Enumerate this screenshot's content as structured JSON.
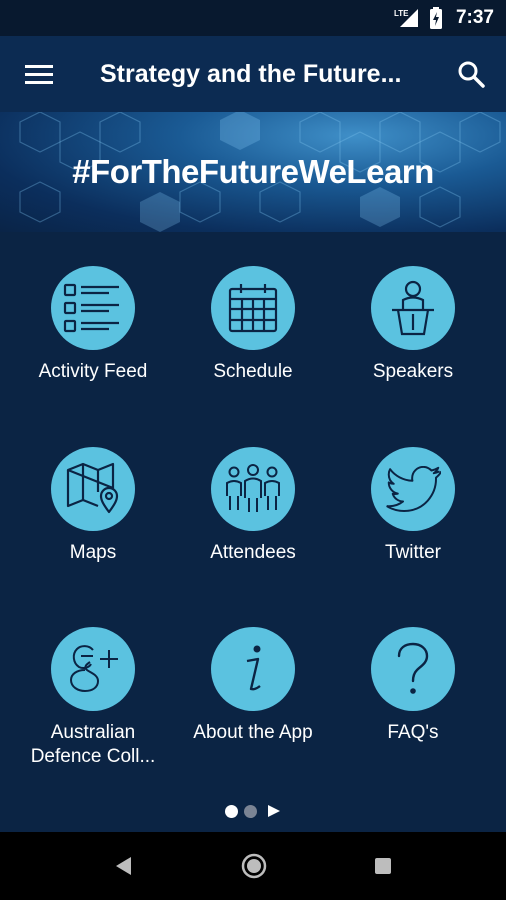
{
  "status_bar": {
    "network": "LTE",
    "time": "7:37"
  },
  "app_bar": {
    "title": "Strategy and the Future..."
  },
  "banner": {
    "hashtag": "#ForTheFutureWeLearn"
  },
  "tiles": [
    {
      "label": "Activity Feed",
      "icon": "activity-feed-icon"
    },
    {
      "label": "Schedule",
      "icon": "calendar-icon"
    },
    {
      "label": "Speakers",
      "icon": "speaker-podium-icon"
    },
    {
      "label": "Maps",
      "icon": "map-icon"
    },
    {
      "label": "Attendees",
      "icon": "attendees-icon"
    },
    {
      "label": "Twitter",
      "icon": "twitter-bird-icon"
    },
    {
      "label": "Australian Defence Coll...",
      "icon": "google-plus-icon"
    },
    {
      "label": "About the App",
      "icon": "info-icon"
    },
    {
      "label": "FAQ's",
      "icon": "question-mark-icon"
    }
  ],
  "pager": {
    "pages": 2,
    "active_page": 1
  },
  "colors": {
    "background": "#0b2444",
    "app_bar": "#0c2b52",
    "tile_circle": "#5bc2e0",
    "icon_stroke": "#0b2444"
  }
}
